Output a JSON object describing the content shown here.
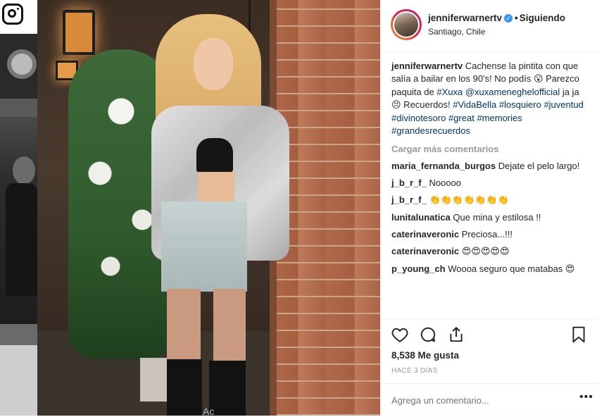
{
  "header": {
    "username": "jenniferwarnertv",
    "verified_mark": "✓",
    "separator": "•",
    "follow_status": "Siguiendo",
    "location": "Santiago, Chile"
  },
  "caption": {
    "username": "jenniferwarnertv",
    "text_1": "Cachense la pintita con que salía a bailar en los 90's! No podís ",
    "emoji_1": "😮",
    "text_2": " Parezco paquita de ",
    "tag_xuxa": "#Xuxa",
    "mention": "@xuxameneghelofficial",
    "text_3": " ja ja ",
    "emoji_2": "😣",
    "text_4": " Recuerdos! ",
    "hashtags": [
      "#VidaBella",
      "#losquiero",
      "#juventud",
      "#divinotesoro",
      "#great",
      "#memories",
      "#grandesrecuerdos"
    ]
  },
  "load_more": "Cargar más comentarios",
  "comments": [
    {
      "user": "maria_fernanda_burgos",
      "text": "Dejate el pelo largo!"
    },
    {
      "user": "j_b_r_f_",
      "text": "Nooooo"
    },
    {
      "user": "j_b_r_f_",
      "text": "👏👏👏👏👏👏👏"
    },
    {
      "user": "lunitalunatica",
      "text": "Que mina y estilosa !!"
    },
    {
      "user": "caterinaveronic",
      "text": "Preciosa...!!!"
    },
    {
      "user": "caterinaveronic",
      "text": "😍😍😍😍😍"
    },
    {
      "user": "p_young_ch",
      "text": "Woooa seguro que matabas 😍"
    }
  ],
  "likes": "8,538 Me gusta",
  "time": "HACE 3 DÍAS",
  "add_comment_placeholder": "Agrega un comentario...",
  "more_options": "•••",
  "overlay_text": "Ac",
  "icons": {
    "brand": "instagram-icon",
    "like": "heart-icon",
    "comment": "comment-icon",
    "share": "share-icon",
    "save": "bookmark-icon"
  },
  "colors": {
    "link": "#003569",
    "verified": "#3897f0",
    "muted": "#999999"
  }
}
